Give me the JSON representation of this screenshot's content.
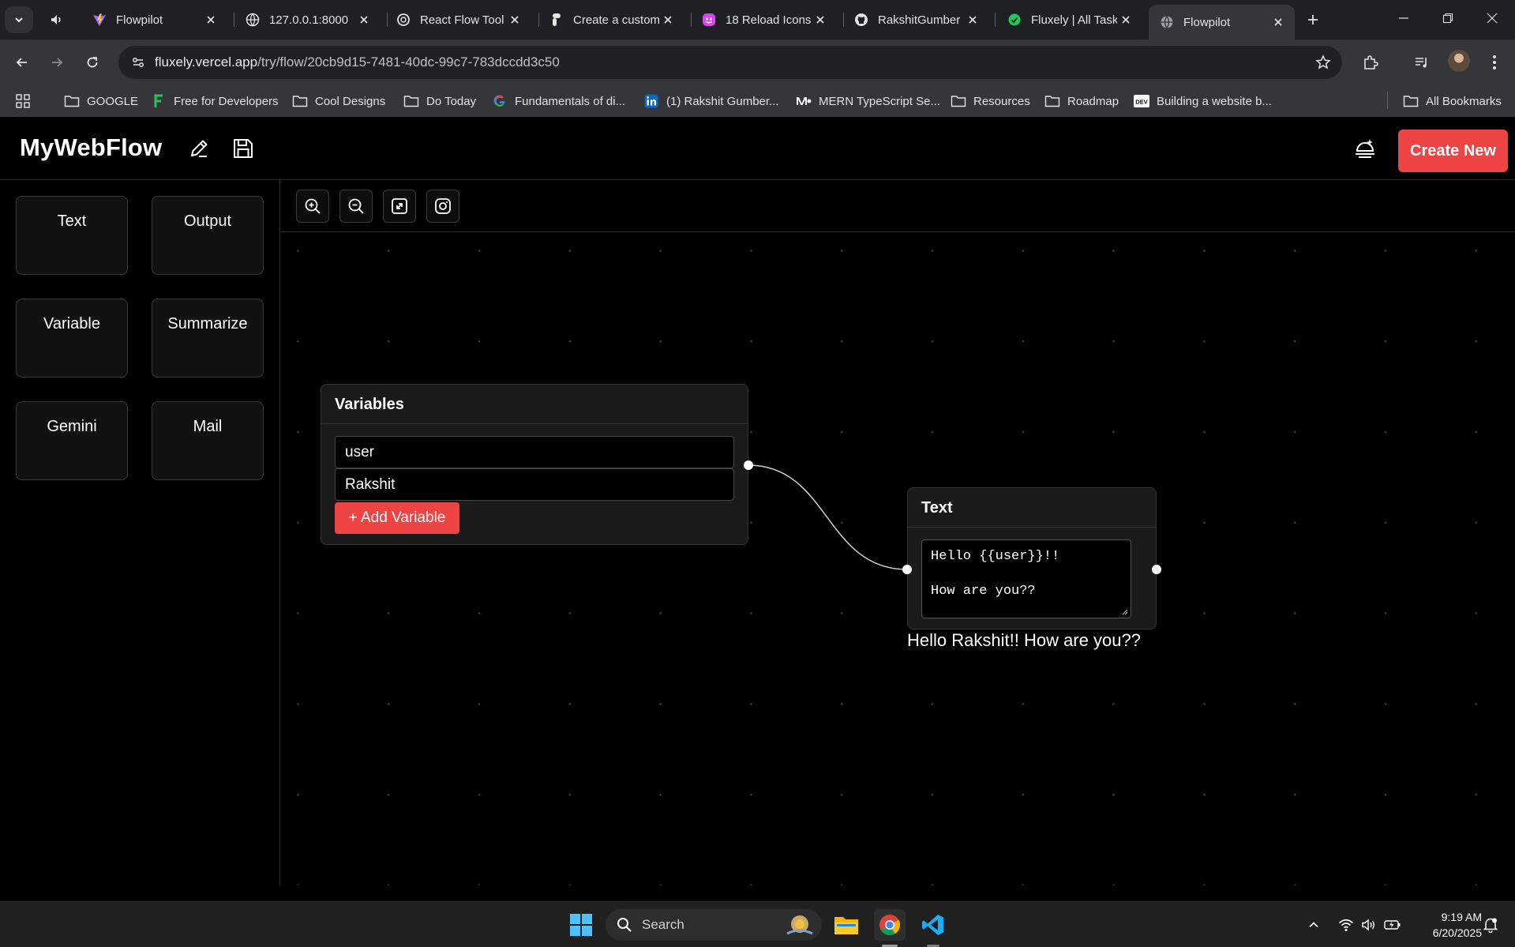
{
  "browser": {
    "tabs": [
      {
        "title": "Flowpilot",
        "icon": "vite-icon"
      },
      {
        "title": "127.0.0.1:8000",
        "icon": "globe-icon"
      },
      {
        "title": "React Flow Tool",
        "icon": "openai-icon"
      },
      {
        "title": "Create a custom",
        "icon": "figma-icon"
      },
      {
        "title": "18 Reload Icons",
        "icon": "icon-site-icon"
      },
      {
        "title": "RakshitGumber",
        "icon": "github-icon"
      },
      {
        "title": "Fluxely | All Task",
        "icon": "check-icon"
      },
      {
        "title": "Flowpilot",
        "icon": "globe-icon",
        "active": true
      }
    ],
    "url_host": "fluxely.vercel.app",
    "url_path": "/try/flow/20cb9d15-7481-40dc-99c7-783dccdd3c50",
    "bookmarks": [
      {
        "label": "GOOGLE",
        "icon": "folder-icon"
      },
      {
        "label": "Free for Developers",
        "icon": "f-logo-icon"
      },
      {
        "label": "Cool Designs",
        "icon": "folder-icon"
      },
      {
        "label": "Do Today",
        "icon": "folder-icon"
      },
      {
        "label": "Fundamentals of di...",
        "icon": "google-icon"
      },
      {
        "label": "(1) Rakshit Gumber...",
        "icon": "linkedin-icon"
      },
      {
        "label": "MERN TypeScript Se...",
        "icon": "medium-icon"
      },
      {
        "label": "Resources",
        "icon": "folder-icon"
      },
      {
        "label": "Roadmap",
        "icon": "folder-icon"
      },
      {
        "label": "Building a website b...",
        "icon": "dev-icon"
      }
    ],
    "all_bookmarks": "All Bookmarks"
  },
  "app": {
    "title": "MyWebFlow",
    "create_new": "Create New",
    "palette": [
      "Text",
      "Output",
      "Variable",
      "Summarize",
      "Gemini",
      "Mail"
    ],
    "variables_node": {
      "title": "Variables",
      "inputs": [
        "user",
        "Rakshit"
      ],
      "add_button": "+ Add Variable"
    },
    "text_node": {
      "title": "Text",
      "content": "Hello {{user}}!!\n\nHow are you??",
      "output": "Hello Rakshit!! How are you??"
    }
  },
  "taskbar": {
    "search_label": "Search",
    "time": "9:19 AM",
    "date": "6/20/2025"
  },
  "colors": {
    "accent": "#ef4444",
    "canvas_bg": "#000000",
    "node_bg": "#1a1a1a"
  }
}
